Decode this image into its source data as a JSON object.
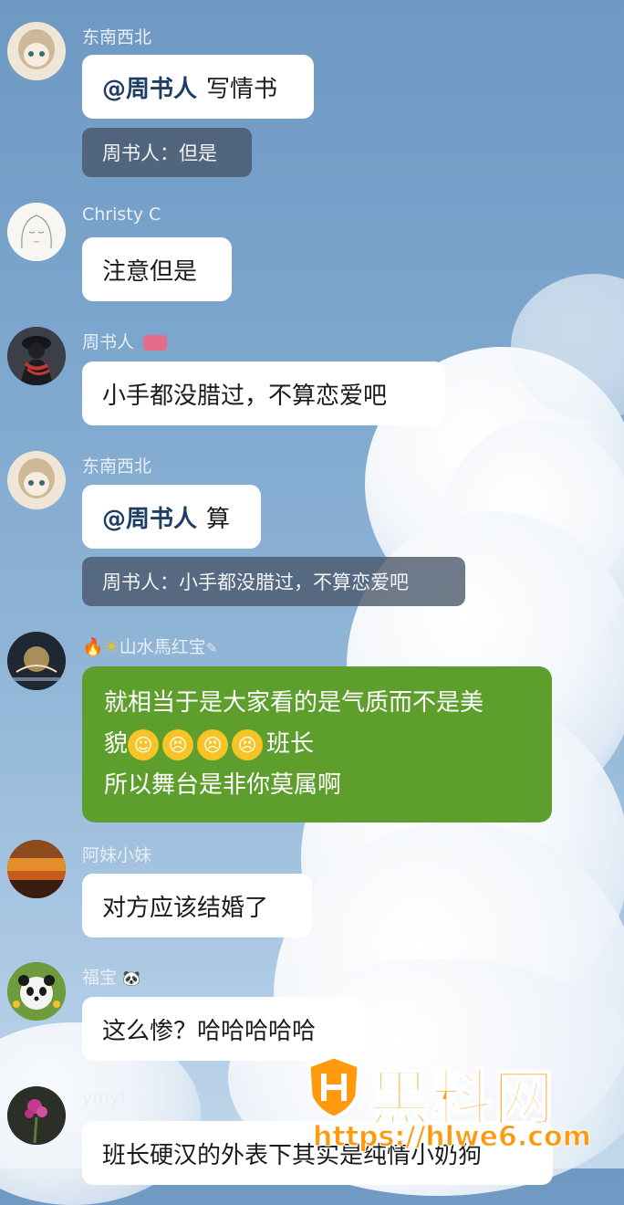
{
  "messages": [
    {
      "sender": "东南西北",
      "mention": "@周书人",
      "text": "写情书",
      "quote": "周书人：但是"
    },
    {
      "sender": "Christy C",
      "text": "注意但是"
    },
    {
      "sender": "周书人",
      "text": "小手都没腊过，不算恋爱吧"
    },
    {
      "sender": "东南西北",
      "mention": "@周书人",
      "text": "算",
      "quote": "周书人：小手都没腊过，不算恋爱吧"
    },
    {
      "sender": "山水馬红宝",
      "line1": "就相当于是大家看的是气质而不是美",
      "line2_prefix": "貌",
      "line2_suffix": "班长",
      "line3": "所以舞台是非你莫属啊"
    },
    {
      "sender": "阿妹小妹",
      "text": "对方应该结婚了"
    },
    {
      "sender": "福宝",
      "text": "这么惨？哈哈哈哈哈"
    },
    {
      "sender": "ymy!",
      "text": "班长硬汉的外表下其实是纯情小奶狗"
    }
  ],
  "watermark": {
    "title": "黑料网",
    "url": "https://hlwe6.com"
  },
  "icons": {
    "avatar_doll": "doll-avatar-icon",
    "avatar_sketch": "sketch-girl-avatar-icon",
    "avatar_dark": "hooded-figure-avatar-icon",
    "avatar_sunset": "sunset-avatar-icon",
    "avatar_panda": "panda-avatar-icon",
    "avatar_flower": "flower-avatar-icon"
  },
  "colors": {
    "green_bubble": "#5e9e2c",
    "mention": "#1f3e66",
    "watermark": "#ff9a0e"
  }
}
